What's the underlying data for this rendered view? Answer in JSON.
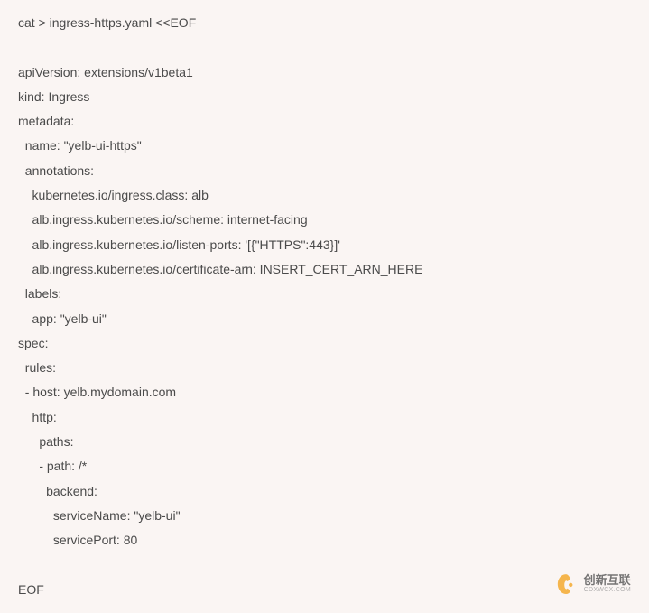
{
  "code": {
    "lines": [
      "cat > ingress-https.yaml <<EOF",
      "",
      "apiVersion: extensions/v1beta1",
      "kind: Ingress",
      "metadata:",
      "  name: \"yelb-ui-https\"",
      "  annotations:",
      "    kubernetes.io/ingress.class: alb",
      "    alb.ingress.kubernetes.io/scheme: internet-facing",
      "    alb.ingress.kubernetes.io/listen-ports: '[{\"HTTPS\":443}]'",
      "    alb.ingress.kubernetes.io/certificate-arn: INSERT_CERT_ARN_HERE",
      "  labels:",
      "    app: \"yelb-ui\"",
      "spec:",
      "  rules:",
      "  - host: yelb.mydomain.com",
      "    http:",
      "      paths:",
      "      - path: /*",
      "        backend:",
      "          serviceName: \"yelb-ui\"",
      "          servicePort: 80",
      "",
      "EOF"
    ]
  },
  "watermark": {
    "main": "创新互联",
    "sub": "CDXWCX.COM"
  }
}
